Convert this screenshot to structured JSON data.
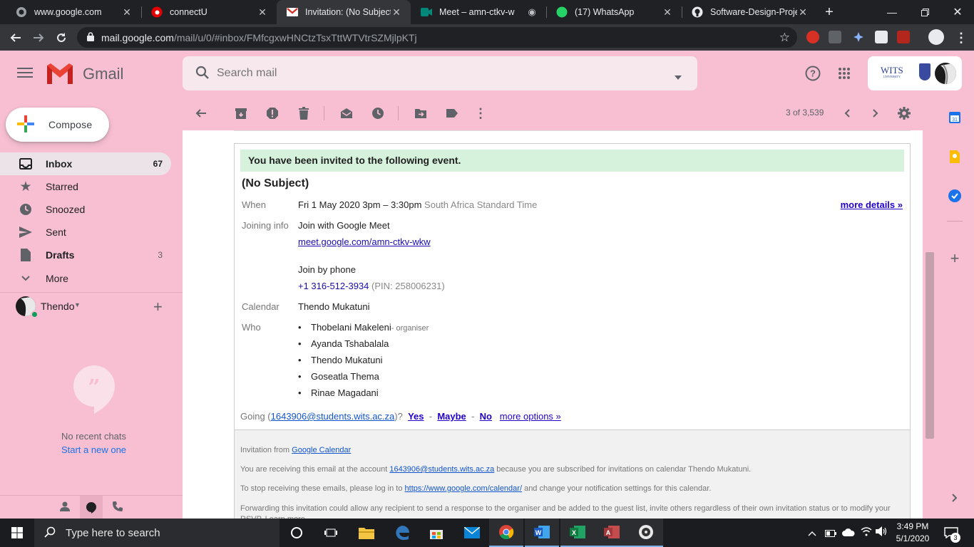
{
  "browser": {
    "tabs": [
      {
        "title": "www.google.com",
        "icon": "google-g-icon",
        "active": false
      },
      {
        "title": "connectU",
        "icon": "vodafone-icon",
        "active": false
      },
      {
        "title": "Invitation: (No Subject)",
        "icon": "gmail-icon",
        "active": true
      },
      {
        "title": "Meet – amn-ctkv-w",
        "icon": "meet-icon",
        "active": false
      },
      {
        "title": "(17) WhatsApp",
        "icon": "whatsapp-icon",
        "active": false
      },
      {
        "title": "Software-Design-Projec",
        "icon": "github-icon",
        "active": false
      }
    ],
    "whatsapp_badge": "17",
    "url_host": "mail.google.com",
    "url_path": "/mail/u/0/#inbox/FMfcgxwHNCtzTsxTttWTVtrSZMjlpKTj",
    "ext_badge": "1"
  },
  "gmail": {
    "brand": "Gmail",
    "search_placeholder": "Search mail",
    "account_org": "WITS",
    "account_org_sub": "UNIVERSITY",
    "compose_label": "Compose",
    "nav": [
      {
        "label": "Inbox",
        "count": "67",
        "icon": "inbox-icon"
      },
      {
        "label": "Starred",
        "count": "",
        "icon": "star-icon"
      },
      {
        "label": "Snoozed",
        "count": "",
        "icon": "clock-icon"
      },
      {
        "label": "Sent",
        "count": "",
        "icon": "send-icon"
      },
      {
        "label": "Drafts",
        "count": "3",
        "icon": "draft-icon"
      },
      {
        "label": "More",
        "count": "",
        "icon": "chevron-down-icon"
      }
    ],
    "hangouts_user": "Thendo",
    "no_chats": "No recent chats",
    "start_new": "Start a new one",
    "pager": "3 of 3,539"
  },
  "invite": {
    "banner": "You have been invited to the following event.",
    "title": "(No Subject)",
    "when_label": "When",
    "when_value": "Fri 1 May 2020 3pm – 3:30pm",
    "timezone": "South Africa Standard Time",
    "more_details": "more details »",
    "joining_label": "Joining info",
    "join_meet": "Join with Google Meet",
    "meet_link": "meet.google.com/amn-ctkv-wkw",
    "join_phone": "Join by phone",
    "phone": "+1 316-512-3934",
    "pin": "(PIN: 258006231)",
    "calendar_label": "Calendar",
    "calendar_value": "Thendo Mukatuni",
    "who_label": "Who",
    "who": [
      {
        "name": "Thobelani Makeleni",
        "note": "- organiser"
      },
      {
        "name": "Ayanda Tshabalala",
        "note": ""
      },
      {
        "name": "Thendo Mukatuni",
        "note": ""
      },
      {
        "name": "Goseatla Thema",
        "note": ""
      },
      {
        "name": "Rinae Magadani",
        "note": ""
      }
    ],
    "going_prefix": "Going (",
    "going_email": "1643906@students.wits.ac.za",
    "going_suffix": ")?",
    "yes": "Yes",
    "maybe": "Maybe",
    "no": "No",
    "dash": "-",
    "more_options": "more options »"
  },
  "footer": {
    "inv_from_prefix": "Invitation from ",
    "inv_from_link": "Google Calendar",
    "receiving_prefix": "You are receiving this email at the account ",
    "receiving_email": "1643906@students.wits.ac.za",
    "receiving_suffix": " because you are subscribed for invitations on calendar Thendo Mukatuni.",
    "stop_prefix": "To stop receiving these emails, please log in to ",
    "stop_link": "https://www.google.com/calendar/",
    "stop_suffix": " and change your notification settings for this calendar.",
    "forwarding": "Forwarding this invitation could allow any recipient to send a response to the organiser and be added to the guest list, invite others regardless of their own invitation status or to modify your RSVP. Learn more"
  },
  "taskbar": {
    "search_placeholder": "Type here to search",
    "time": "3:49 PM",
    "date": "5/1/2020",
    "notif_count": "3"
  },
  "colors": {
    "gmail_bg": "#f7bfd1",
    "banner_green": "#d6f2dd",
    "link_blue": "#1155cc"
  }
}
